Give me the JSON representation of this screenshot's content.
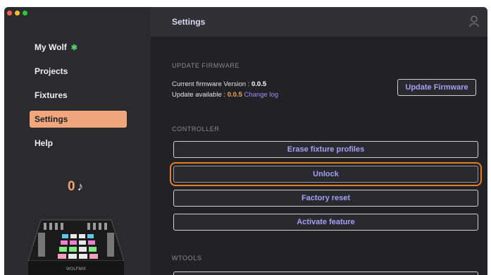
{
  "window": {
    "traffic_colors": [
      "#ff5f57",
      "#febc2e",
      "#28c840"
    ]
  },
  "sidebar": {
    "items": [
      {
        "label": "My Wolf",
        "icon": "leaf-icon"
      },
      {
        "label": "Projects"
      },
      {
        "label": "Fixtures"
      },
      {
        "label": "Settings",
        "active": true
      },
      {
        "label": "Help"
      }
    ],
    "counter_value": "0",
    "counter_icon": "music-note-icon",
    "device_label": "WOLFMIX"
  },
  "header": {
    "title": "Settings",
    "user_icon": "user-icon"
  },
  "firmware": {
    "section_title": "UPDATE FIRMWARE",
    "current_label": "Current firmware Version : ",
    "current_version": "0.0.5",
    "available_label": "Update available : ",
    "available_version": "0.0.5",
    "changelog_label": "Change log",
    "update_button": "Update Firmware"
  },
  "controller": {
    "section_title": "CONTROLLER",
    "buttons": [
      "Erase fixture profiles",
      "Unlock",
      "Factory reset",
      "Activate feature"
    ]
  },
  "wtools": {
    "section_title": "WTOOLS"
  },
  "colors": {
    "accent": "#a79ff5",
    "active_nav": "#f0a77e",
    "highlight": "#e67e22"
  }
}
